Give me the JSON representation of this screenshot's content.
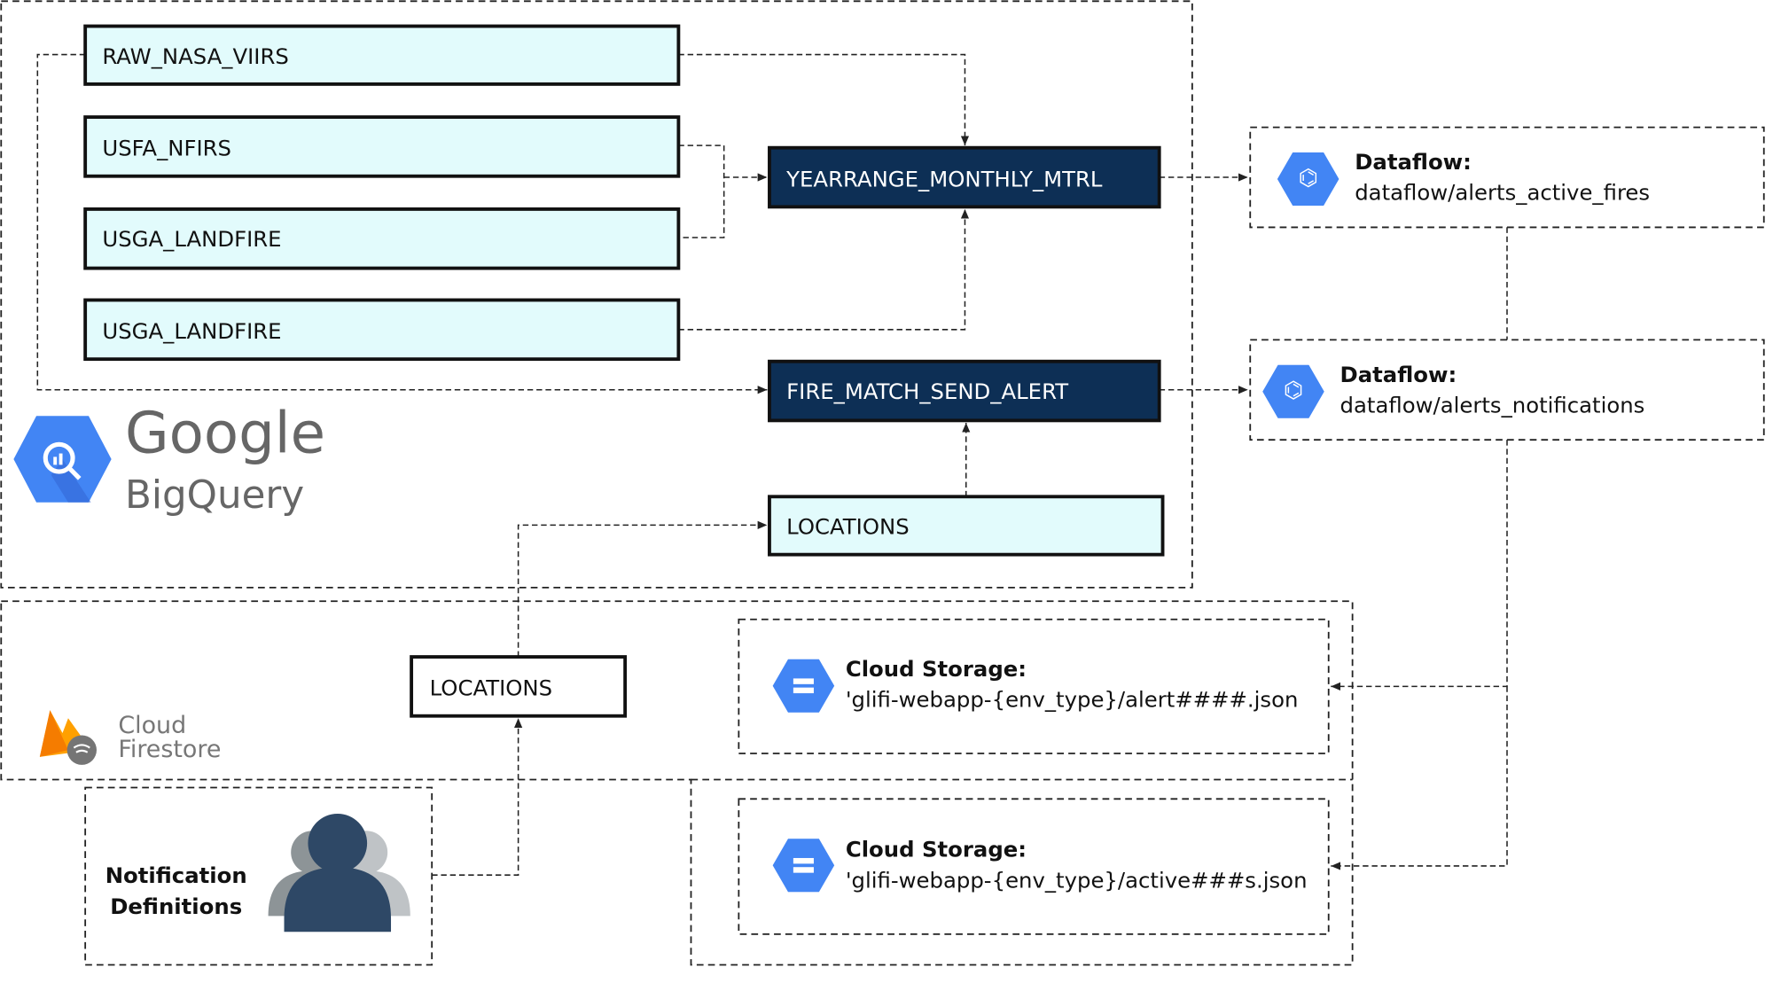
{
  "bigquery": {
    "logo_line1": "Google",
    "logo_line2": "BigQuery",
    "tables": [
      "RAW_NASA_VIIRS",
      "USFA_NFIRS",
      "USGA_LANDFIRE",
      "USGA_LANDFIRE"
    ],
    "views": [
      "YEARRANGE_MONTHLY_MTRL",
      "FIRE_MATCH_SEND_ALERT"
    ],
    "locations": "LOCATIONS"
  },
  "dataflow": [
    {
      "title": "Dataflow:",
      "path": "dataflow/alerts_active_fires"
    },
    {
      "title": "Dataflow:",
      "path": "dataflow/alerts_notifications"
    }
  ],
  "firestore": {
    "logo_line1": "Cloud",
    "logo_line2": "Firestore",
    "locations": "LOCATIONS"
  },
  "storage": [
    {
      "title": "Cloud Storage:",
      "path": "'glifi-webapp-{env_type}/alert####.json"
    },
    {
      "title": "Cloud Storage:",
      "path": "'glifi-webapp-{env_type}/active###s.json"
    }
  ],
  "notification": {
    "line1": "Notification",
    "line2": "Definitions"
  },
  "colors": {
    "table_fill": "#e2fbfc",
    "view_fill": "#0d2f55",
    "gcp_blue": "#4285f4"
  }
}
